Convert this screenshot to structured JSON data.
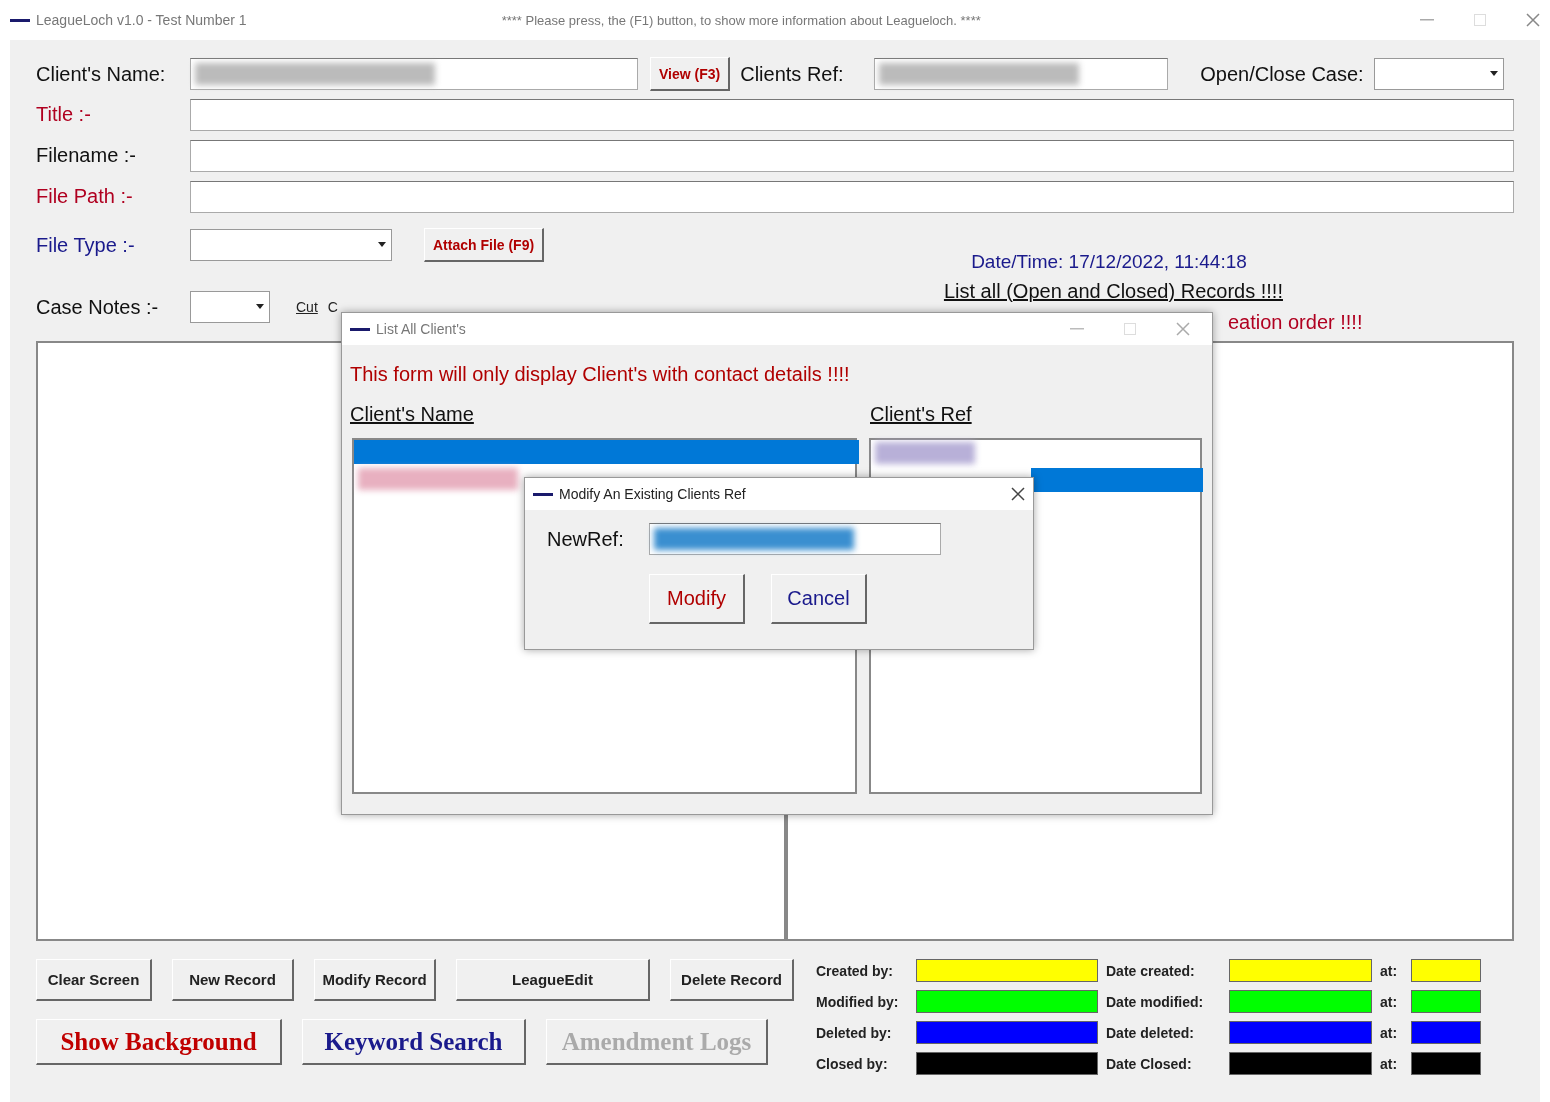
{
  "window": {
    "title": "LeagueLoch v1.0 - Test Number 1",
    "notice": "**** Please press, the (F1) button, to show more information about Leagueloch. ****"
  },
  "form": {
    "client_name_label": "Client's Name:",
    "view_button": "View (F3)",
    "clients_ref_label": "Clients Ref:",
    "open_close_label": "Open/Close Case:",
    "title_label": "Title :-",
    "filename_label": "Filename :-",
    "file_path_label": "File Path :-",
    "file_type_label": "File Type :-",
    "attach_button": "Attach File (F9)",
    "case_notes_label": "Case Notes :-",
    "cut": "Cut",
    "copy_partial": "C",
    "datetime": "Date/Time: 17/12/2022, 11:44:18",
    "list_all_link": "List all (Open and Closed) Records !!!!",
    "order_partial": "eation order !!!!"
  },
  "buttons_row1": [
    "Clear Screen",
    "New Record",
    "Modify Record",
    "LeagueEdit",
    "Delete Record"
  ],
  "buttons_row2": [
    {
      "label": "Show Background",
      "disabled": false,
      "color": "#c00000"
    },
    {
      "label": "Keyword Search",
      "disabled": false,
      "color": "#1a1a8c"
    },
    {
      "label": "Amendment Logs",
      "disabled": true
    }
  ],
  "audit": [
    {
      "by_label": "Created by:",
      "date_label": "Date created:",
      "at_label": "at:",
      "color": "#ffff00"
    },
    {
      "by_label": "Modified by:",
      "date_label": "Date modified:",
      "at_label": "at:",
      "color": "#00ff00"
    },
    {
      "by_label": "Deleted by:",
      "date_label": "Date deleted:",
      "at_label": "at:",
      "color": "#0000ff"
    },
    {
      "by_label": "Closed by:",
      "date_label": "Date Closed:",
      "at_label": "at:",
      "color": "#000000"
    }
  ],
  "list_dialog": {
    "title": "List All Client's",
    "warning": "This form will only display Client's with contact details !!!!",
    "name_header": "Client's Name",
    "ref_header": "Client's Ref"
  },
  "modify_dialog": {
    "title": "Modify An Existing Clients Ref",
    "newref_label": "NewRef:",
    "buttons": [
      "Modify",
      "Cancel"
    ]
  }
}
